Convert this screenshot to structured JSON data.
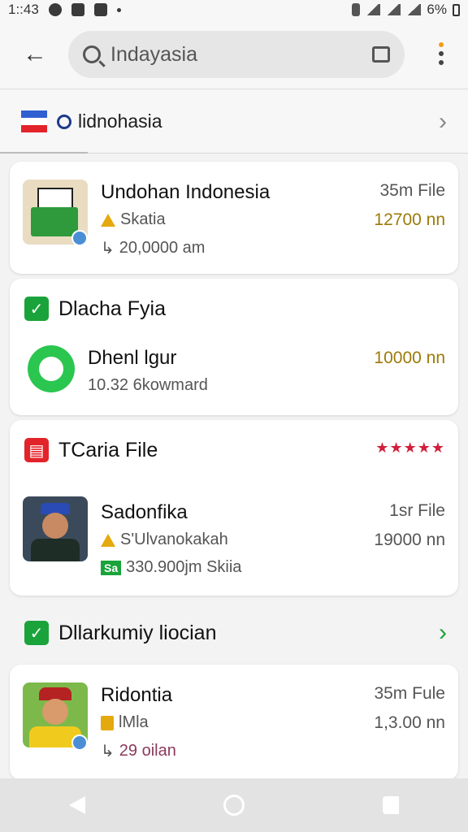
{
  "status_bar": {
    "time": "1::43",
    "battery": "6%"
  },
  "search": {
    "query": "Indayasia"
  },
  "filter_row": {
    "label": "lidnohasia"
  },
  "cards": [
    {
      "title": "Undohan Indonesia",
      "subtitle": "Skatia",
      "detail": "20,0000 am",
      "meta_top": "35m File",
      "meta_bottom": "12700 nn"
    },
    {
      "section_title": "Dlacha Fyia",
      "title": "Dhenl lgur",
      "detail": "10.32 6kowmard",
      "meta": "10000 nn"
    },
    {
      "section_title": "TCaria File",
      "rating": "★★★★★",
      "title": "Sadonfika",
      "subtitle": "S'Ulvanokakah",
      "badge": "Sa",
      "detail": "330.900jm Skiia",
      "meta_top": "1sr File",
      "meta_bottom": "19000 nn"
    },
    {
      "title": "Ridontia",
      "subtitle": "lMla",
      "detail": "29 oilan",
      "meta_top": "35m Fule",
      "meta_bottom": "1,3.00 nn"
    }
  ],
  "section": {
    "title": "Dllarkumiy liocian"
  }
}
